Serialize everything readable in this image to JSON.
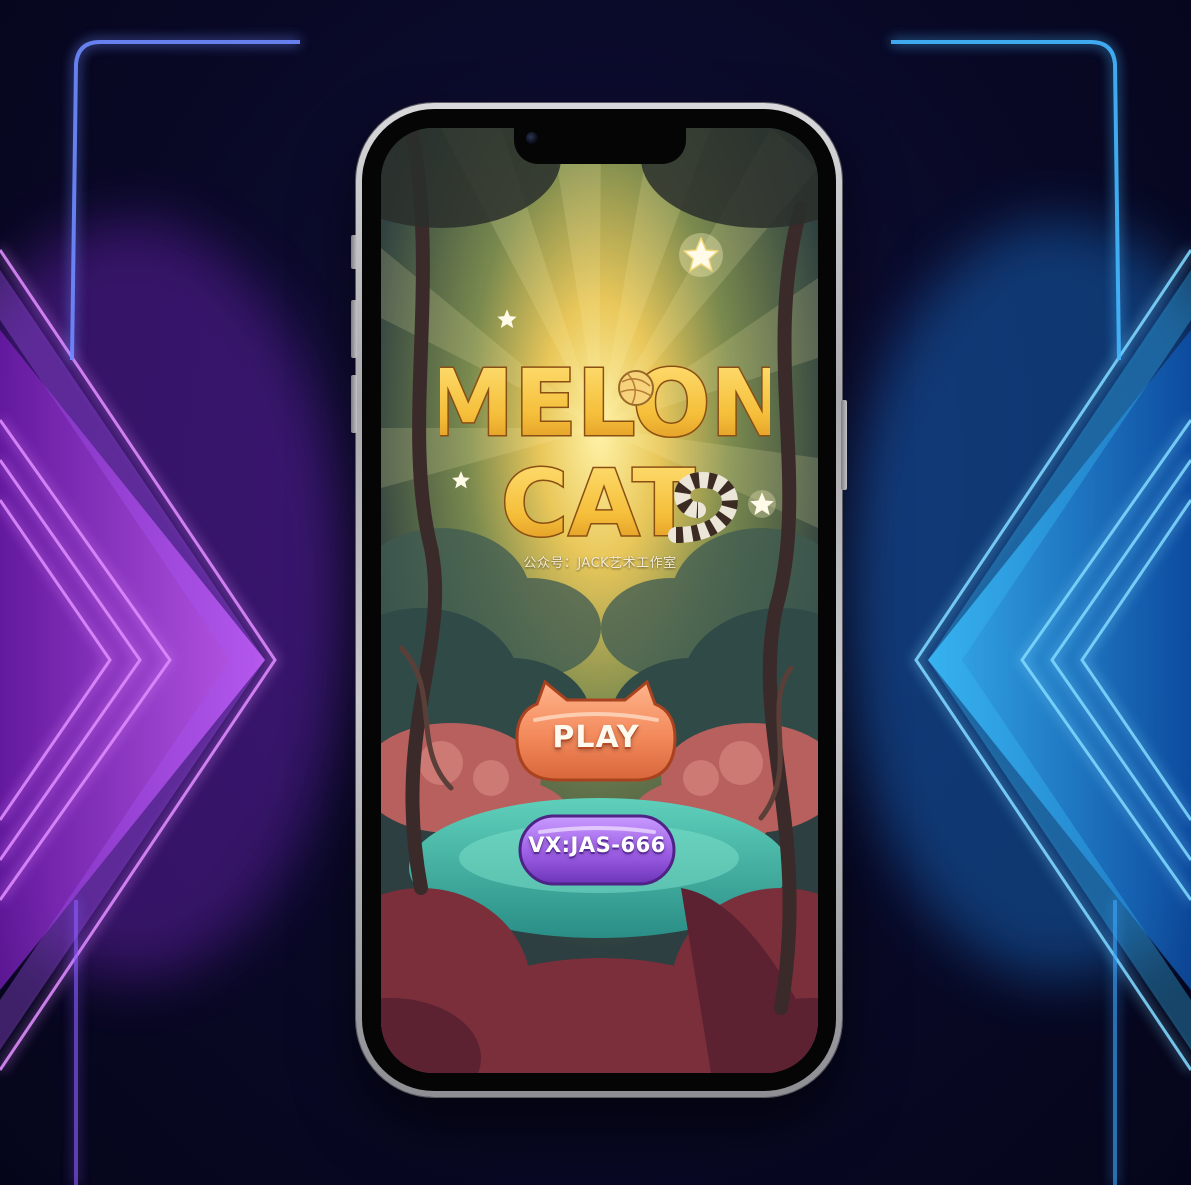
{
  "game": {
    "title_line1": "MELON",
    "title_line2": "CAT",
    "subtitle": "公众号：JACK艺术工作室",
    "play_label": "PLAY",
    "vx_label": "VX:JAS-666"
  },
  "icons": {
    "stars": [
      "star-icon",
      "star-icon",
      "star-icon",
      "star-icon"
    ],
    "yarn": "yarn-ball-icon",
    "tail": "striped-tail-icon"
  },
  "colors": {
    "background": "#07061c",
    "neon_purple": "#c84dff",
    "neon_blue": "#2fa8ff",
    "play_orange": "#f08a5b",
    "vx_purple": "#9d5ee6",
    "logo_gold": "#f5bf3a"
  }
}
